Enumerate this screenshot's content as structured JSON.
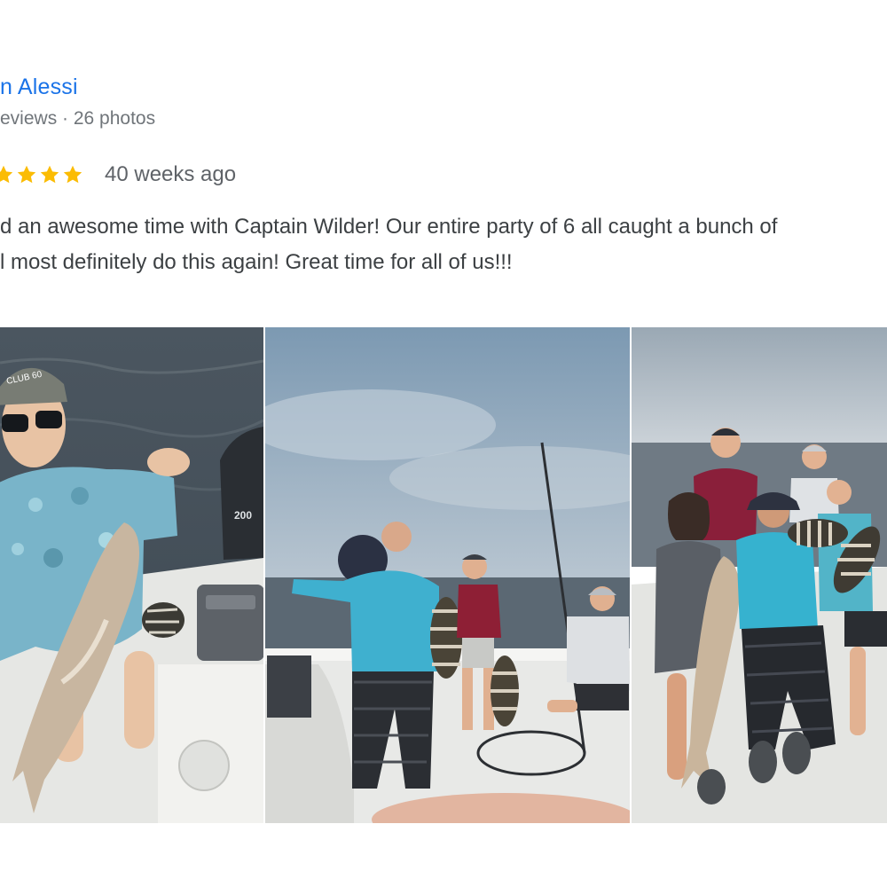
{
  "reviewer": {
    "name": "n Alessi",
    "meta": "eviews · 26 photos"
  },
  "rating": {
    "stars": 4,
    "star_color": "#fbbc04",
    "time_ago": "40 weeks ago"
  },
  "review": {
    "lines": [
      "d an awesome time with Captain Wilder! Our entire party of 6 all caught a bunch of",
      "l most definitely do this again! Great time for all of us!!!"
    ]
  },
  "photos": [
    {
      "subject": "angler in blue camo shirt holding a redfish and sheepshead on a boat",
      "hat_text": "CLUB 60",
      "motor_text": "200"
    },
    {
      "subject": "man in teal shirt and two kids holding sheepshead on a boat deck"
    },
    {
      "subject": "group of six on a boat holding a redfish and sheepshead"
    }
  ],
  "colors": {
    "name_link": "#1a73e8",
    "meta": "#70757a",
    "body_text": "#3c4043"
  }
}
